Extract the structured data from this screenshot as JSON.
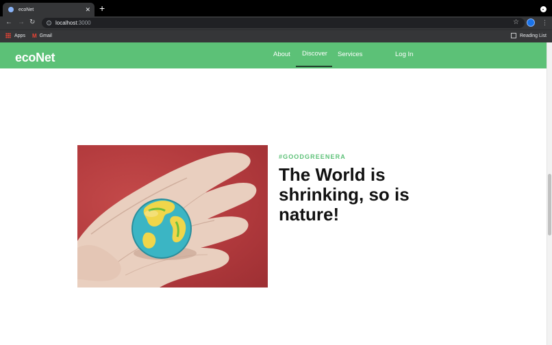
{
  "browser": {
    "tab_title": "ecoNet",
    "url_host": "localhost",
    "url_port": ":3000",
    "bookmarks": {
      "apps_label": "Apps",
      "gmail_label": "Gmail",
      "reading_list_label": "Reading List"
    }
  },
  "site": {
    "brand": "ecoNet",
    "nav": {
      "about": "About",
      "discover": "Discover",
      "services": "Services",
      "login": "Log In"
    },
    "active_nav": "Discover",
    "accent_color": "#5cc177"
  },
  "hero": {
    "tag": "#GOODGREENERA",
    "headline": "The World is shrinking, so is nature!"
  }
}
